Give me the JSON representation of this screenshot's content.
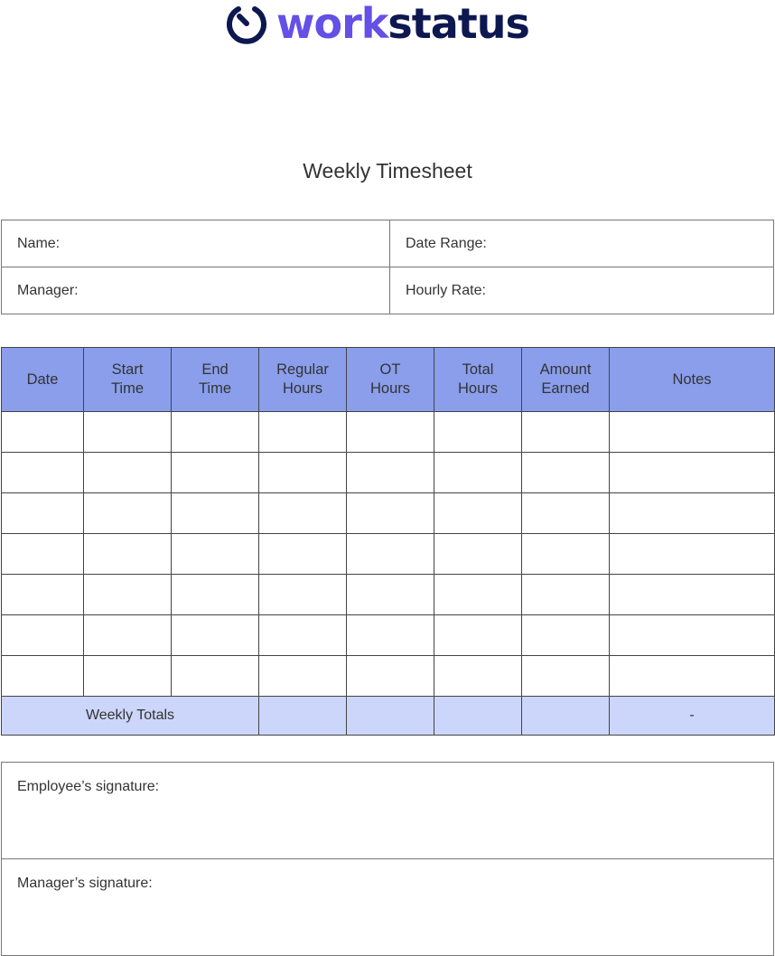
{
  "brand": {
    "icon": "stopwatch-icon",
    "name_part1": "work",
    "name_part2": "status",
    "colors": {
      "primary": "#6450e6",
      "dark": "#0d1850"
    }
  },
  "title": "Weekly Timesheet",
  "info": {
    "name_label": "Name:",
    "date_range_label": "Date Range:",
    "manager_label": "Manager:",
    "hourly_rate_label": "Hourly Rate:"
  },
  "timesheet": {
    "header_color": "#8a9eec",
    "totals_color": "#ccd6fa",
    "columns": [
      "Date",
      "Start Time",
      "End Time",
      "Regular Hours",
      "OT Hours",
      "Total Hours",
      "Amount Earned",
      "Notes"
    ],
    "row_count": 7,
    "totals_label": "Weekly Totals",
    "totals_notes": "-"
  },
  "signatures": {
    "employee_label": "Employee’s signature:",
    "manager_label": "Manager’s signature:"
  }
}
